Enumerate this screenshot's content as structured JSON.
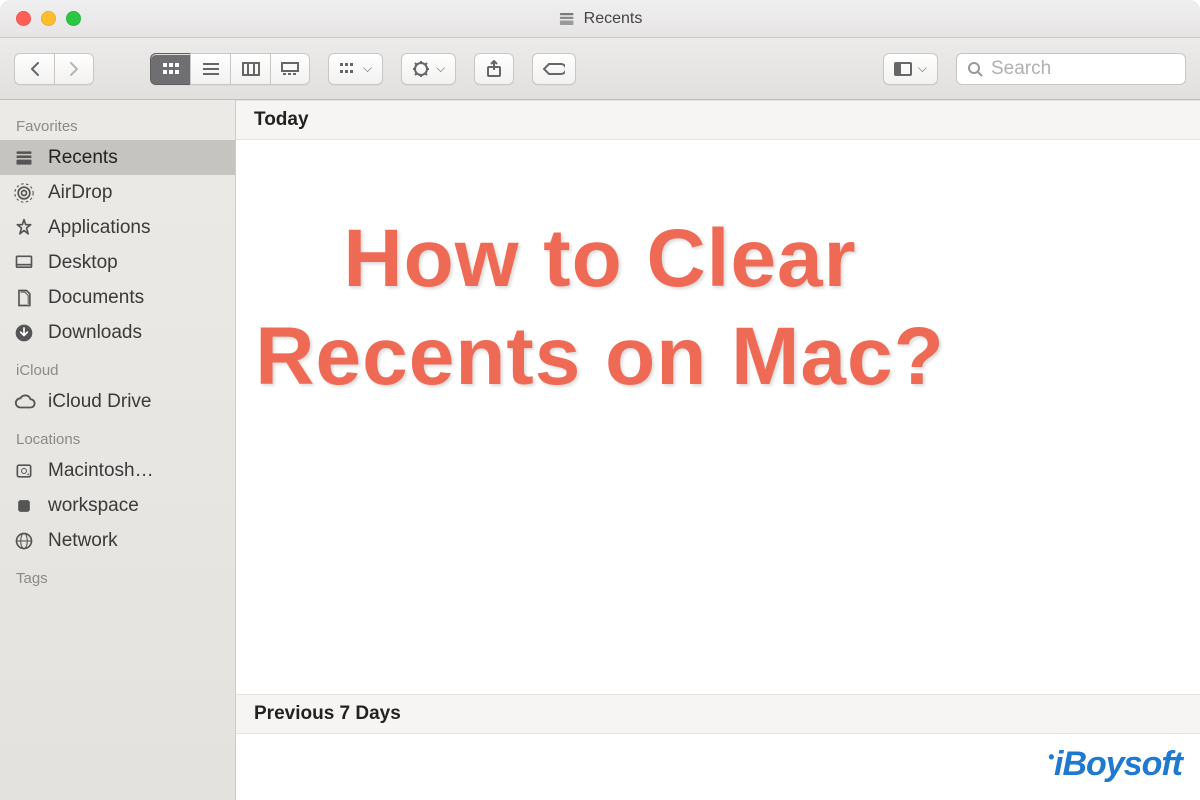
{
  "window": {
    "title": "Recents"
  },
  "search": {
    "placeholder": "Search"
  },
  "sidebar": {
    "sections": [
      {
        "title": "Favorites",
        "items": [
          {
            "label": "Recents",
            "icon": "recents-icon",
            "selected": true
          },
          {
            "label": "AirDrop",
            "icon": "airdrop-icon",
            "selected": false
          },
          {
            "label": "Applications",
            "icon": "applications-icon",
            "selected": false
          },
          {
            "label": "Desktop",
            "icon": "desktop-icon",
            "selected": false
          },
          {
            "label": "Documents",
            "icon": "documents-icon",
            "selected": false
          },
          {
            "label": "Downloads",
            "icon": "downloads-icon",
            "selected": false
          }
        ]
      },
      {
        "title": "iCloud",
        "items": [
          {
            "label": "iCloud Drive",
            "icon": "icloud-icon",
            "selected": false
          }
        ]
      },
      {
        "title": "Locations",
        "items": [
          {
            "label": "Macintosh…",
            "icon": "hdd-icon",
            "selected": false
          },
          {
            "label": "workspace",
            "icon": "volume-icon",
            "selected": false
          },
          {
            "label": "Network",
            "icon": "network-icon",
            "selected": false
          }
        ]
      },
      {
        "title": "Tags",
        "items": []
      }
    ]
  },
  "content": {
    "groups": [
      {
        "label": "Today"
      },
      {
        "label": "Previous 7 Days"
      }
    ]
  },
  "overlay": {
    "text": "How to Clear\nRecents on Mac?"
  },
  "branding": {
    "logo_text": "iBoysoft"
  }
}
